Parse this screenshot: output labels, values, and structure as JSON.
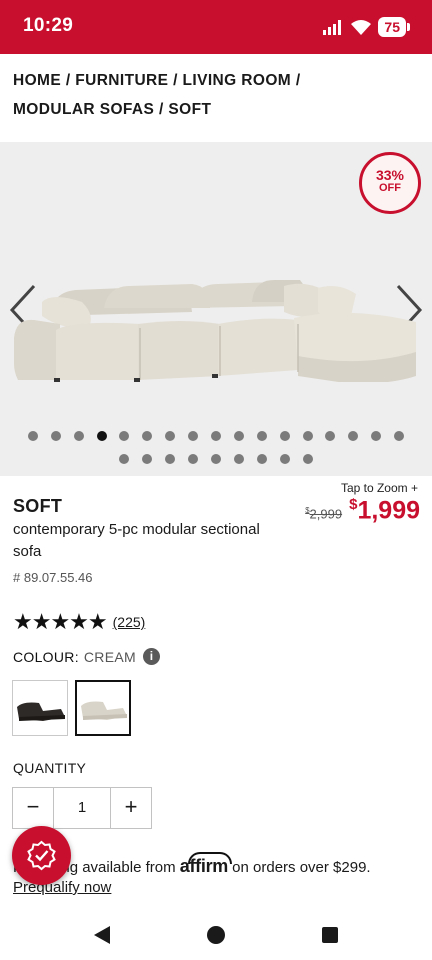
{
  "status_bar": {
    "time": "10:29",
    "battery": "75"
  },
  "breadcrumb": {
    "items": [
      "HOME",
      "FURNITURE",
      "LIVING ROOM",
      "MODULAR SOFAS",
      "SOFT"
    ],
    "separator": " / "
  },
  "gallery": {
    "badge_percent": "33%",
    "badge_off": "OFF",
    "dots_total": 26,
    "active_dot": 4,
    "icons": {
      "prev": "chevron-left-icon",
      "next": "chevron-right-icon"
    }
  },
  "product": {
    "name": "SOFT",
    "description": "contemporary 5-pc modular sectional sofa",
    "sku": "# 89.07.55.46",
    "tap_to_zoom": "Tap to Zoom",
    "tap_to_zoom_icon": "+",
    "old_price": {
      "currency": "$",
      "amount": "2,999"
    },
    "new_price": {
      "currency": "$",
      "amount": "1,999"
    },
    "stars": "★★★★★",
    "rating_value": 5,
    "review_count": "(225)"
  },
  "colour": {
    "label": "COLOUR:",
    "value": "CREAM",
    "info_icon": "i",
    "swatches": [
      "dark",
      "cream"
    ],
    "selected_index": 1
  },
  "quantity": {
    "label": "QUANTITY",
    "value": "1",
    "minus": "−",
    "plus": "+"
  },
  "financing": {
    "text_start": "Financing available from",
    "brand": "affirm",
    "text_end": "on orders over $299.",
    "prequalify": "Prequalify now"
  },
  "colors": {
    "brand_red": "#c8102e",
    "gallery_bg": "#eeeeee"
  }
}
